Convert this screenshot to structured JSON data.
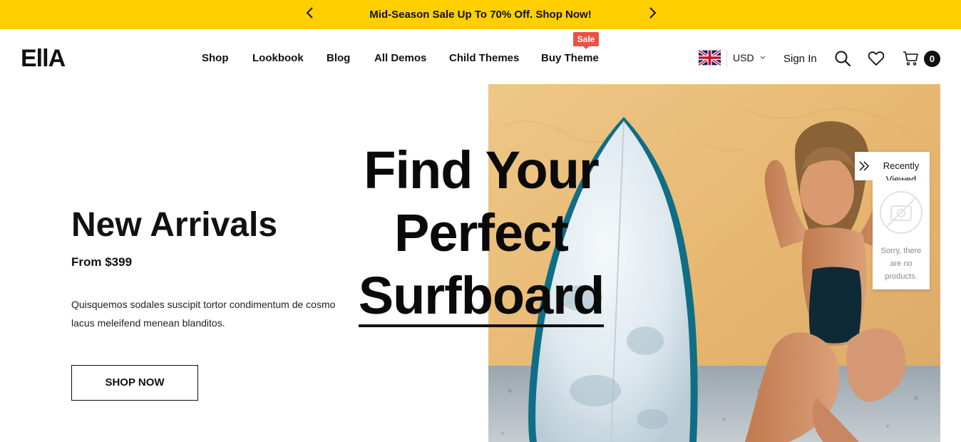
{
  "announcement": {
    "message": "Mid-Season Sale Up To 70% Off. Shop Now!",
    "prev_icon": "chevron-left-icon",
    "next_icon": "chevron-right-icon"
  },
  "header": {
    "logo": "EllA",
    "nav": [
      {
        "label": "Shop"
      },
      {
        "label": "Lookbook"
      },
      {
        "label": "Blog"
      },
      {
        "label": "All Demos"
      },
      {
        "label": "Child Themes"
      },
      {
        "label": "Buy Theme",
        "badge": "Sale"
      }
    ],
    "flag_icon": "uk-flag-icon",
    "currency": "USD",
    "sign_in": "Sign In",
    "cart_count": "0",
    "accent": "#ffcf00",
    "badge_color": "#e95144"
  },
  "hero": {
    "left_title": "New Arrivals",
    "price_text": "From $399",
    "description": "Quisquemos sodales suscipit tortor condimentum de cosmo lacus meleifend menean blanditos.",
    "cta": "SHOP NOW",
    "headline_line1": "Find Your",
    "headline_line2": "Perfect",
    "headline_line3": "Surfboard"
  },
  "recently_viewed": {
    "title": "Recently Viewed",
    "empty_text": "Sorry, there are no products."
  }
}
